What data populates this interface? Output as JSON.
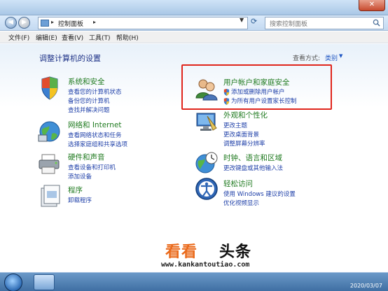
{
  "window": {
    "close_label": "✕",
    "nav": {
      "back_icon": "back-arrow-icon",
      "forward_icon": "forward-arrow-icon"
    },
    "address": {
      "text": "控制面板",
      "arrow": "▸"
    },
    "search": {
      "placeholder": "搜索控制面板"
    }
  },
  "menu": [
    "文件(F)",
    "编辑(E)",
    "查看(V)",
    "工具(T)",
    "帮助(H)"
  ],
  "main": {
    "heading": "调整计算机的设置",
    "view_by_label": "查看方式:",
    "view_by_value": "类别",
    "view_arrow": "▼"
  },
  "categories": [
    {
      "title": "系统和安全",
      "icon": "system-security-icon",
      "links": [
        "查看您的计算机状态",
        "备份您的计算机",
        "查找并解决问题"
      ]
    },
    {
      "title": "网络和 Internet",
      "icon": "network-icon",
      "links": [
        "查看网络状态和任务",
        "选择家庭组和共享选项"
      ]
    },
    {
      "title": "硬件和声音",
      "icon": "hardware-printer-icon",
      "links": [
        "查看设备和打印机",
        "添加设备"
      ]
    },
    {
      "title": "程序",
      "icon": "programs-icon",
      "links": [
        "卸载程序"
      ]
    },
    {
      "title": "用户帐户和家庭安全",
      "icon": "user-accounts-icon",
      "links": [
        "添加或删除用户帐户",
        "为所有用户设置家长控制"
      ]
    },
    {
      "title": "外观和个性化",
      "icon": "appearance-icon",
      "links": [
        "更改主题",
        "更改桌面背景",
        "调整屏幕分辨率"
      ]
    },
    {
      "title": "时钟、语言和区域",
      "icon": "clock-globe-icon",
      "links": [
        "更改键盘或其他输入法"
      ]
    },
    {
      "title": "轻松访问",
      "icon": "ease-of-access-icon",
      "links": [
        "使用 Windows 建议的设置",
        "优化视频显示"
      ]
    }
  ],
  "watermark": {
    "logo_a": "看看",
    "logo_b": "头条",
    "url": "www.kankantoutiao.com"
  },
  "taskbar": {
    "date": "2020/03/07"
  },
  "colors": {
    "category_title": "#1f7a1f",
    "link": "#1e3fa8",
    "highlight": "#e0251c",
    "watermark_orange": "#ea6a1b"
  }
}
